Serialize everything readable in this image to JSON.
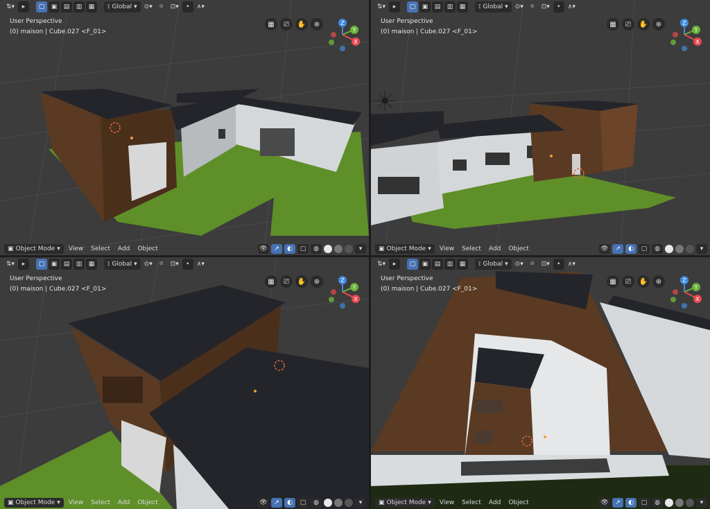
{
  "header": {
    "transform_orientation": "Global",
    "mode_icon": "cursor-arrow-icon"
  },
  "viewport_info": {
    "perspective": "User Perspective",
    "object_info": "(0) maison | Cube.027 <F_01>"
  },
  "footer": {
    "mode": "Object Mode",
    "menus": [
      "View",
      "Select",
      "Add",
      "Object"
    ]
  },
  "gizmo_axes": {
    "x": "X",
    "y": "Y",
    "z": "Z"
  },
  "colors": {
    "viewport_bg": "#3c3c3c",
    "grass": "#5f8f28",
    "wall_brown": "#5a3a22",
    "roof": "#2a2b2e",
    "wall_white": "#d2d6d8",
    "axis_x": "#e8484f",
    "axis_y": "#6bb23a",
    "axis_z": "#3f8be0",
    "accent": "#4772b3"
  }
}
